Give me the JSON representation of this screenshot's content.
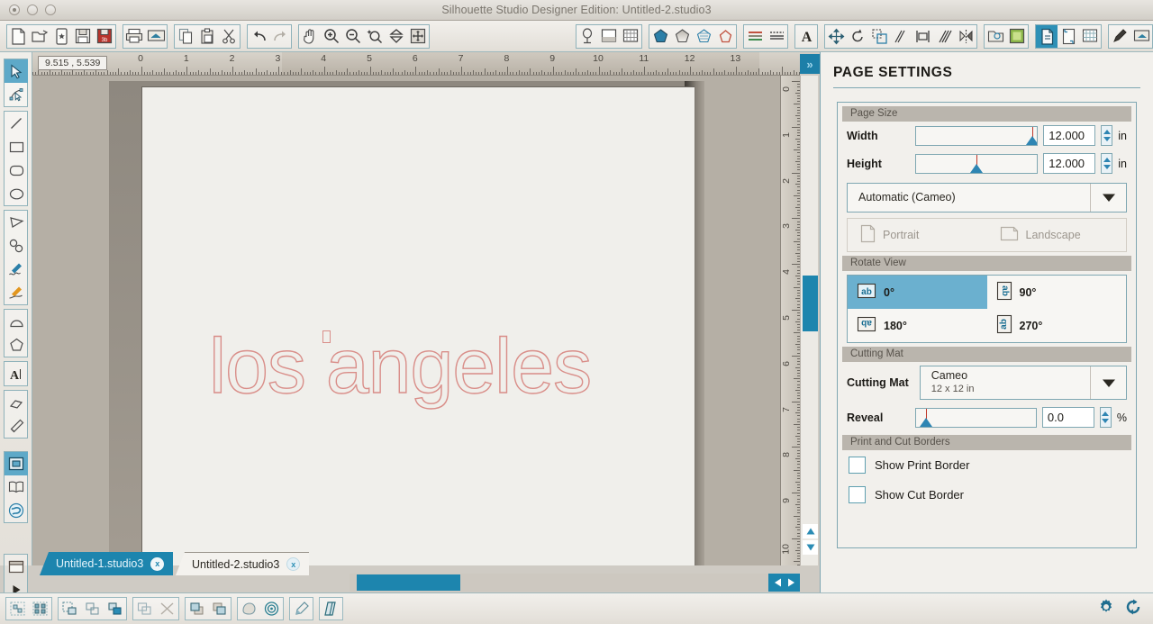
{
  "window": {
    "title": "Silhouette Studio Designer Edition: Untitled-2.studio3",
    "controls": [
      "close",
      "minimize",
      "zoom"
    ]
  },
  "toolbar": {
    "groups": [
      {
        "name": "file",
        "buttons": [
          {
            "icon": "new-document-icon",
            "label": "New"
          },
          {
            "icon": "open-folder-icon",
            "label": "Open"
          },
          {
            "icon": "new-from-library-icon",
            "label": "New From Library"
          },
          {
            "icon": "save-icon",
            "label": "Save"
          },
          {
            "icon": "save-3d-icon",
            "label": "Save As"
          }
        ]
      },
      {
        "name": "print",
        "buttons": [
          {
            "icon": "print-icon",
            "label": "Print"
          },
          {
            "icon": "send-to-silhouette-icon",
            "label": "Send to Silhouette"
          }
        ]
      },
      {
        "name": "clipboard",
        "buttons": [
          {
            "icon": "copy-icon",
            "label": "Copy"
          },
          {
            "icon": "paste-icon",
            "label": "Paste"
          },
          {
            "icon": "cut-scissors-icon",
            "label": "Cut"
          }
        ]
      },
      {
        "name": "history",
        "buttons": [
          {
            "icon": "undo-icon",
            "label": "Undo"
          },
          {
            "icon": "redo-icon",
            "label": "Redo"
          }
        ]
      },
      {
        "name": "view",
        "buttons": [
          {
            "icon": "pan-hand-icon",
            "label": "Pan"
          },
          {
            "icon": "zoom-in-icon",
            "label": "Zoom In"
          },
          {
            "icon": "zoom-out-icon",
            "label": "Zoom Out"
          },
          {
            "icon": "zoom-selection-icon",
            "label": "Zoom to Selection"
          },
          {
            "icon": "fit-to-page-icon",
            "label": "Fit to Page"
          },
          {
            "icon": "fit-to-window-icon",
            "label": "Fit to Window"
          }
        ]
      },
      {
        "name": "design-panels",
        "buttons": [
          {
            "icon": "cut-style-icon",
            "label": "Cut Settings"
          },
          {
            "icon": "page-setup-icon",
            "label": "Page Setup"
          },
          {
            "icon": "grid-settings-icon",
            "label": "Grid"
          }
        ]
      },
      {
        "name": "fill-line",
        "buttons": [
          {
            "icon": "fill-color-icon",
            "label": "Fill Color"
          },
          {
            "icon": "fill-gradient-icon",
            "label": "Fill Gradient"
          },
          {
            "icon": "fill-pattern-icon",
            "label": "Fill Pattern"
          },
          {
            "icon": "line-color-icon",
            "label": "Line Color"
          }
        ]
      },
      {
        "name": "line-style",
        "buttons": [
          {
            "icon": "line-style-icon",
            "label": "Line Style"
          },
          {
            "icon": "sketch-style-icon",
            "label": "Sketch Style"
          }
        ]
      },
      {
        "name": "text",
        "buttons": [
          {
            "icon": "text-style-icon",
            "label": "Text Style"
          }
        ]
      },
      {
        "name": "transform",
        "buttons": [
          {
            "icon": "move-icon",
            "label": "Move"
          },
          {
            "icon": "rotate-icon",
            "label": "Rotate"
          },
          {
            "icon": "scale-icon",
            "label": "Scale"
          },
          {
            "icon": "shear-icon",
            "label": "Shear"
          },
          {
            "icon": "align-icon",
            "label": "Align"
          },
          {
            "icon": "replicate-icon",
            "label": "Replicate"
          },
          {
            "icon": "mirror-icon",
            "label": "Mirror"
          }
        ]
      },
      {
        "name": "library",
        "buttons": [
          {
            "icon": "my-library-icon",
            "label": "My Library"
          },
          {
            "icon": "store-icon",
            "label": "Silhouette Store"
          }
        ]
      },
      {
        "name": "page-view",
        "buttons": [
          {
            "icon": "page-settings-icon",
            "label": "Page Settings",
            "selected": true
          },
          {
            "icon": "registration-marks-icon",
            "label": "Registration Marks"
          },
          {
            "icon": "grid-icon",
            "label": "Grid"
          }
        ]
      },
      {
        "name": "material",
        "buttons": [
          {
            "icon": "pen-tool-icon",
            "label": "Sketch Pens"
          },
          {
            "icon": "cut-send-icon",
            "label": "Cut"
          }
        ]
      }
    ]
  },
  "left_rail": {
    "groups": [
      {
        "name": "select",
        "tools": [
          {
            "icon": "selection-arrow-icon",
            "label": "Select",
            "selected": true
          },
          {
            "icon": "edit-points-icon",
            "label": "Edit Points"
          }
        ]
      },
      {
        "name": "shapes",
        "tools": [
          {
            "icon": "line-tool-icon",
            "label": "Draw a Line"
          },
          {
            "icon": "rectangle-tool-icon",
            "label": "Draw a Rectangle"
          },
          {
            "icon": "rounded-rectangle-tool-icon",
            "label": "Draw a Rounded Rectangle"
          },
          {
            "icon": "ellipse-tool-icon",
            "label": "Draw an Ellipse"
          }
        ]
      },
      {
        "name": "draw",
        "tools": [
          {
            "icon": "polygon-tool-icon",
            "label": "Draw a Polygon"
          },
          {
            "icon": "curve-tool-icon",
            "label": "Draw a Curve Shape"
          },
          {
            "icon": "freehand-tool-icon",
            "label": "Draw Freehand"
          },
          {
            "icon": "smooth-freehand-tool-icon",
            "label": "Draw Smooth Freehand"
          }
        ]
      },
      {
        "name": "specialty",
        "tools": [
          {
            "icon": "arc-tool-icon",
            "label": "Draw an Arc"
          },
          {
            "icon": "regular-polygon-tool-icon",
            "label": "Draw a Regular Polygon"
          }
        ]
      },
      {
        "name": "text",
        "tools": [
          {
            "icon": "text-tool-icon",
            "label": "Draw a Text"
          }
        ]
      },
      {
        "name": "erase",
        "tools": [
          {
            "icon": "eraser-tool-icon",
            "label": "Eraser"
          },
          {
            "icon": "knife-tool-icon",
            "label": "Knife"
          }
        ]
      },
      {
        "name": "panels",
        "tools": [
          {
            "icon": "design-page-icon",
            "label": "Design Page",
            "selected": true
          },
          {
            "icon": "library-book-icon",
            "label": "Library"
          },
          {
            "icon": "store-globe-icon",
            "label": "Store"
          }
        ]
      },
      {
        "name": "send",
        "tools": [
          {
            "icon": "preview-window-icon",
            "label": "Preview"
          },
          {
            "icon": "send-play-icon",
            "label": "Send"
          }
        ]
      }
    ]
  },
  "canvas": {
    "coordinates": "9.515 , 5.539",
    "artwork_text": "los angeles",
    "artwork_outline_color": "#d98e89",
    "page_background": "#f0efeb",
    "ruler_unit": "in",
    "ruler_h_ticks": [
      0,
      1,
      2,
      3,
      4,
      5,
      6,
      7,
      8,
      9,
      10,
      11,
      12,
      13
    ],
    "ruler_v_ticks": [
      0,
      1,
      2,
      3,
      4,
      5,
      6,
      7,
      8,
      9,
      10
    ],
    "expand_panel_icon": "double-chevron-right-icon"
  },
  "tabs": [
    {
      "label": "Untitled-1.studio3",
      "close": "x",
      "active": false
    },
    {
      "label": "Untitled-2.studio3",
      "close": "x",
      "active": true
    }
  ],
  "panel": {
    "title": "PAGE SETTINGS",
    "sections": {
      "page_size": {
        "header": "Page Size",
        "width": {
          "label": "Width",
          "value": "12.000",
          "unit": "in",
          "slider_pct": 96
        },
        "height": {
          "label": "Height",
          "value": "12.000",
          "unit": "in",
          "slider_pct": 50
        },
        "machine": {
          "value": "Automatic (Cameo)",
          "arrow": "chevron-down-icon"
        },
        "orientation": {
          "portrait": {
            "label": "Portrait",
            "icon": "portrait-page-icon"
          },
          "landscape": {
            "label": "Landscape",
            "icon": "landscape-page-icon"
          }
        }
      },
      "rotate_view": {
        "header": "Rotate View",
        "options": [
          {
            "label": "0°",
            "icon": "rotate-0-icon",
            "selected": true
          },
          {
            "label": "90°",
            "icon": "rotate-90-icon",
            "selected": false
          },
          {
            "label": "180°",
            "icon": "rotate-180-icon",
            "selected": false
          },
          {
            "label": "270°",
            "icon": "rotate-270-icon",
            "selected": false
          }
        ]
      },
      "cutting_mat": {
        "header": "Cutting Mat",
        "label": "Cutting Mat",
        "value": "Cameo",
        "sub": "12 x 12 in",
        "arrow": "chevron-down-icon",
        "reveal": {
          "label": "Reveal",
          "value": "0.0",
          "unit": "%",
          "slider_pct": 8
        }
      },
      "print_cut_borders": {
        "header": "Print and Cut Borders",
        "show_print_border": {
          "label": "Show Print Border",
          "checked": false
        },
        "show_cut_border": {
          "label": "Show Cut Border",
          "checked": false
        }
      }
    }
  },
  "bottom_bar": {
    "groups": [
      {
        "name": "group",
        "buttons": [
          {
            "icon": "group-icon",
            "label": "Group"
          },
          {
            "icon": "ungroup-icon",
            "label": "Ungroup"
          }
        ]
      },
      {
        "name": "compound",
        "buttons": [
          {
            "icon": "make-compound-path-icon",
            "label": "Make Compound Path"
          },
          {
            "icon": "release-compound-path-icon",
            "label": "Release Compound Path"
          },
          {
            "icon": "weld-icon",
            "label": "Weld"
          }
        ]
      },
      {
        "name": "boolean",
        "buttons": [
          {
            "icon": "intersect-icon",
            "label": "Intersect"
          },
          {
            "icon": "subtract-icon",
            "label": "Subtract"
          }
        ]
      },
      {
        "name": "arrange",
        "buttons": [
          {
            "icon": "bring-to-front-icon",
            "label": "Bring to Front"
          },
          {
            "icon": "send-to-back-icon",
            "label": "Send to Back"
          }
        ]
      },
      {
        "name": "trace",
        "buttons": [
          {
            "icon": "offset-icon",
            "label": "Offset"
          },
          {
            "icon": "registration-target-icon",
            "label": "Registration Marks"
          }
        ]
      },
      {
        "name": "paint",
        "buttons": [
          {
            "icon": "eyedropper-icon",
            "label": "Eyedropper"
          }
        ]
      },
      {
        "name": "modify",
        "buttons": [
          {
            "icon": "modify-icon",
            "label": "Modify"
          }
        ]
      }
    ],
    "right_icons": [
      {
        "icon": "gear-icon",
        "label": "Preferences"
      },
      {
        "icon": "sync-refresh-icon",
        "label": "Sync"
      }
    ]
  },
  "colors": {
    "accent_blue": "#1d85ae",
    "panel_border": "#7fa7b2",
    "artwork_stroke": "#d98e89",
    "section_header_bg": "#bab5ad"
  }
}
